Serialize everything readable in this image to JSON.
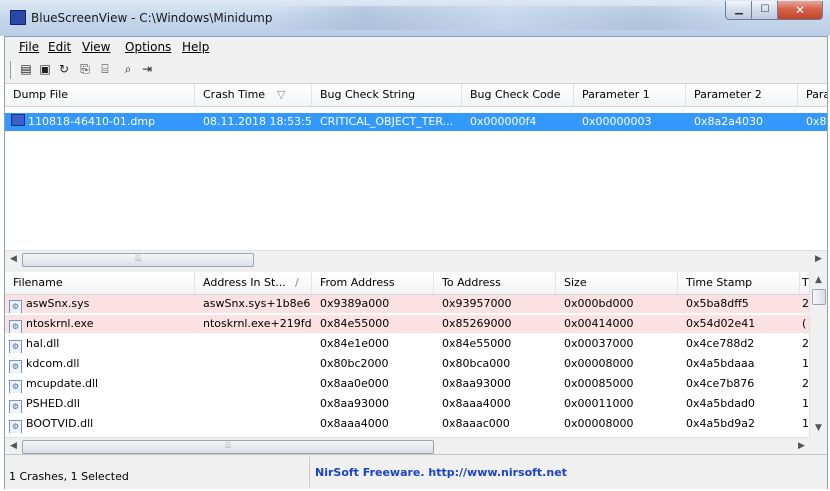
{
  "window": {
    "title": "BlueScreenView  -  C:\\Windows\\Minidump",
    "buttons": {
      "minimize": "▁",
      "maximize": "☐",
      "close": "✕"
    }
  },
  "menu": [
    "File",
    "Edit",
    "View",
    "Options",
    "Help"
  ],
  "toolbar": [
    "properties-icon",
    "save-icon",
    "refresh-icon",
    "copy-icon",
    "html-report-icon",
    "find-icon",
    "exit-icon"
  ],
  "dumps": {
    "columns": [
      "Dump File",
      "Crash Time",
      "Bug Check String",
      "Bug Check Code",
      "Parameter 1",
      "Parameter 2",
      "Para"
    ],
    "sort_marker": "▽",
    "rows": [
      [
        "110818-46410-01.dmp",
        "08.11.2018 18:53:53",
        "CRITICAL_OBJECT_TER...",
        "0x000000f4",
        "0x00000003",
        "0x8a2a4030",
        "0x8..."
      ]
    ]
  },
  "scroll": {
    "left": "◀",
    "right": "▶",
    "up": "▲",
    "down": "▼",
    "grip": "⦙⦙⦙"
  },
  "drivers": {
    "columns": [
      "Filename",
      "Address In St...",
      "From Address",
      "To Address",
      "Size",
      "Time Stamp",
      "T"
    ],
    "sort_marker": "/",
    "rows": [
      {
        "cells": [
          "aswSnx.sys",
          "aswSnx.sys+1b8e6",
          "0x9389a000",
          "0x93957000",
          "0x000bd000",
          "0x5ba8dff5",
          "2"
        ],
        "highlight": true
      },
      {
        "cells": [
          "ntoskrnl.exe",
          "ntoskrnl.exe+219fd0",
          "0x84e55000",
          "0x85269000",
          "0x00414000",
          "0x54d02e41",
          "("
        ],
        "highlight": true
      },
      {
        "cells": [
          "hal.dll",
          "",
          "0x84e1e000",
          "0x84e55000",
          "0x00037000",
          "0x4ce788d2",
          "2"
        ],
        "highlight": false
      },
      {
        "cells": [
          "kdcom.dll",
          "",
          "0x80bc2000",
          "0x80bca000",
          "0x00008000",
          "0x4a5bdaaa",
          "1"
        ],
        "highlight": false
      },
      {
        "cells": [
          "mcupdate.dll",
          "",
          "0x8aa0e000",
          "0x8aa93000",
          "0x00085000",
          "0x4ce7b876",
          "2"
        ],
        "highlight": false
      },
      {
        "cells": [
          "PSHED.dll",
          "",
          "0x8aa93000",
          "0x8aaa4000",
          "0x00011000",
          "0x4a5bdad0",
          "1"
        ],
        "highlight": false
      },
      {
        "cells": [
          "BOOTVID.dll",
          "",
          "0x8aaa4000",
          "0x8aaac000",
          "0x00008000",
          "0x4a5bd9a2",
          "1"
        ],
        "highlight": false
      }
    ]
  },
  "status": {
    "left": "1 Crashes, 1 Selected",
    "center": "NirSoft Freeware.  http://www.nirsoft.net"
  }
}
